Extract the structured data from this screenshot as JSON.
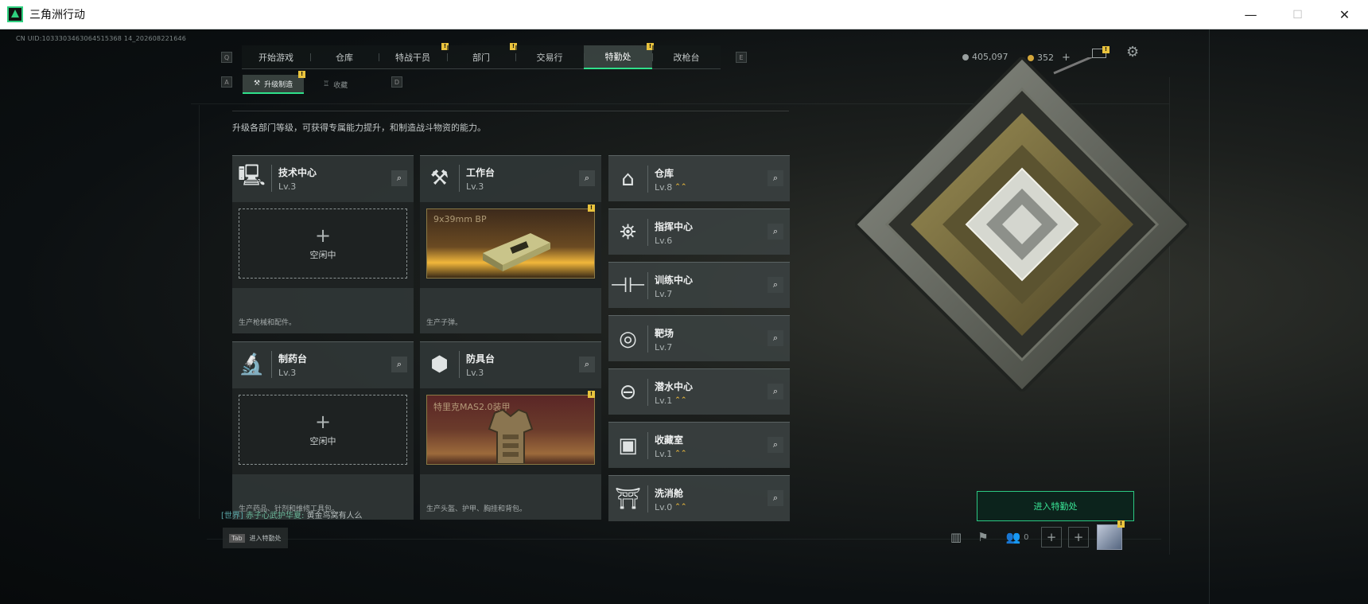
{
  "window": {
    "title": "三角洲行动",
    "min": "—",
    "max": "☐",
    "close": "✕"
  },
  "uid": "CN UID:1033303463064515368 14_202608221646",
  "top_nav": {
    "key_left": "Q",
    "key_right": "E",
    "tabs": [
      {
        "label": "开始游戏"
      },
      {
        "label": "仓库"
      },
      {
        "label": "特战干员",
        "badge": "!"
      },
      {
        "label": "部门",
        "badge": "!"
      },
      {
        "label": "交易行"
      },
      {
        "label": "特勤处",
        "badge": "!",
        "active": true
      },
      {
        "label": "改枪台"
      }
    ]
  },
  "currency": {
    "silver": "405,097",
    "gold": "352",
    "add": "+"
  },
  "sub_nav": {
    "key_left": "A",
    "key_right": "D",
    "tabs": [
      {
        "label": "升级制造",
        "active": true,
        "badge": "!"
      },
      {
        "label": "收藏"
      }
    ]
  },
  "description": "升级各部门等级，可获得专属能力提升，和制造战斗物资的能力。",
  "workshops": [
    {
      "name": "技术中心",
      "level": "Lv.3",
      "status": "空闲中",
      "footer": "生产枪械和配件。",
      "icon": "computer-icon"
    },
    {
      "name": "工作台",
      "level": "Lv.3",
      "product": "9x39mm BP",
      "footer": "生产子弹。",
      "icon": "hammer-wrench-icon",
      "badge": "!"
    },
    {
      "name": "制药台",
      "level": "Lv.3",
      "status": "空闲中",
      "footer": "生产药品、针剂和维修工具包。",
      "icon": "microscope-icon"
    },
    {
      "name": "防具台",
      "level": "Lv.3",
      "product": "特里克MAS2.0装甲",
      "footer": "生产头盔、护甲、胸挂和背包。",
      "icon": "cubes-icon",
      "badge": "!"
    }
  ],
  "facilities": [
    {
      "name": "仓库",
      "level": "Lv.8",
      "upgrade": true,
      "icon": "warehouse-icon"
    },
    {
      "name": "指挥中心",
      "level": "Lv.6",
      "upgrade": false,
      "icon": "command-icon"
    },
    {
      "name": "训练中心",
      "level": "Lv.7",
      "upgrade": false,
      "icon": "dumbbell-icon"
    },
    {
      "name": "靶场",
      "level": "Lv.7",
      "upgrade": false,
      "icon": "target-icon"
    },
    {
      "name": "潜水中心",
      "level": "Lv.1",
      "upgrade": true,
      "icon": "diving-mask-icon"
    },
    {
      "name": "收藏室",
      "level": "Lv.1",
      "upgrade": true,
      "icon": "trophy-case-icon"
    },
    {
      "name": "洗消舱",
      "level": "Lv.0",
      "upgrade": true,
      "icon": "shower-icon"
    }
  ],
  "enter_button": "进入特勤处",
  "chat": {
    "channel": "[世界]",
    "user": "赤子心武护华夏:",
    "message": "黄金鸟窝有人么"
  },
  "tab_hint": {
    "key": "Tab",
    "label": "进入特勤处"
  },
  "bottom": {
    "friends_count": "0",
    "badge": "!"
  },
  "colors": {
    "accent": "#2fe08a",
    "badge": "#e9c33d",
    "upgrade": "#e5b53b"
  }
}
